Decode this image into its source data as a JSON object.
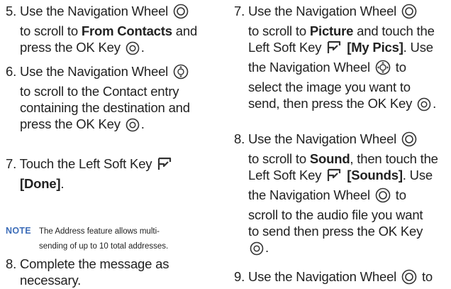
{
  "left": {
    "step5": {
      "num": "5.",
      "l1": "Use the Navigation Wheel",
      "l2a": "to scroll to",
      "l2b": "From Contacts",
      "l2c": "and",
      "l3": "press the OK Key"
    },
    "step6": {
      "num": "6.",
      "l1": "Use the Navigation Wheel",
      "l2": "to scroll to the Contact entry",
      "l3": "containing the destination and",
      "l4": "press the OK Key"
    },
    "step7": {
      "num": "7.",
      "l1": "Touch the Left Soft Key",
      "l2": "[Done]",
      "l2end": "."
    },
    "note": {
      "label": "NOTE",
      "l1": "The Address feature allows multi-",
      "l2": "sending of up to 10 total addresses."
    },
    "step8": {
      "num": "8.",
      "l1": "Complete the message as",
      "l2": "necessary."
    }
  },
  "right": {
    "step7": {
      "num": "7.",
      "l1": "Use the Navigation Wheel",
      "l2a": "to scroll to",
      "l2b": "Picture",
      "l2c": "and touch the",
      "l3a": "Left Soft Key",
      "l3b": "[My Pics]",
      "l3c": ". Use",
      "l4a": "the Navigation Wheel",
      "l4b": "to",
      "l5": "select the image you want to",
      "l6": "send, then press the OK Key"
    },
    "step8": {
      "num": "8.",
      "l1": "Use the Navigation Wheel",
      "l2a": "to scroll to",
      "l2b": "Sound",
      "l2c": ", then touch the",
      "l3a": "Left Soft Key",
      "l3b": "[Sounds]",
      "l3c": ". Use",
      "l4a": "the Navigation Wheel",
      "l4b": "to",
      "l5": "scroll to the audio file you want",
      "l6": "to send then press the OK Key"
    },
    "step9": {
      "num": "9.",
      "l1a": "Use the Navigation Wheel",
      "l1b": "to"
    }
  },
  "icons": {
    "nav_wheel": "navigation-wheel-icon",
    "nav_wheel_4way": "navigation-wheel-four-way-icon",
    "ok_key": "ok-key-icon",
    "left_soft_key": "left-soft-key-icon"
  }
}
